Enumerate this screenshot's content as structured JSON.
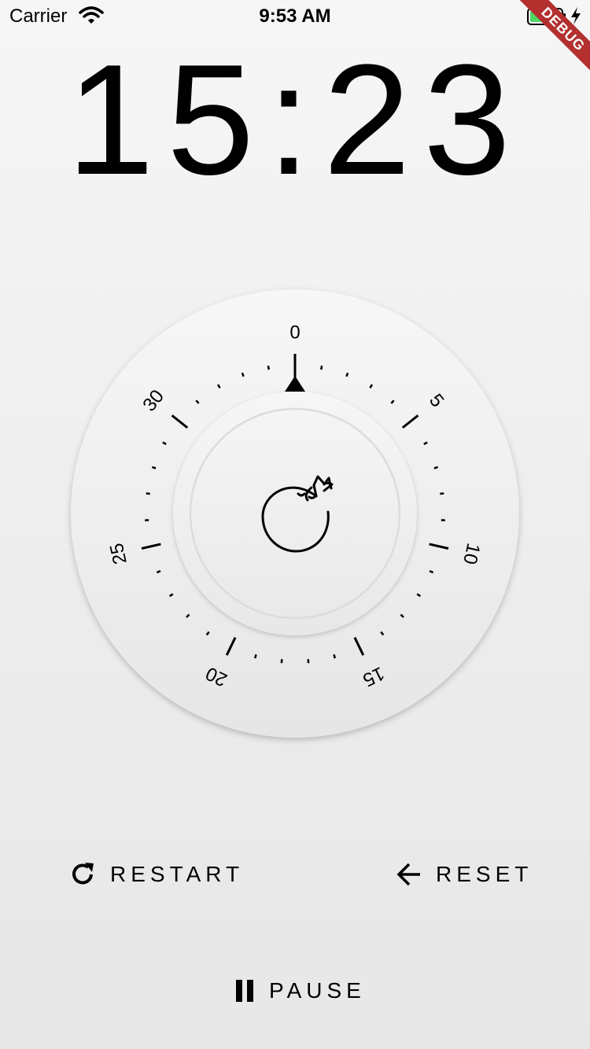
{
  "status_bar": {
    "carrier": "Carrier",
    "time": "9:53 AM"
  },
  "debug_banner": "DEBUG",
  "timer": {
    "display": "15:23"
  },
  "dial": {
    "labels": [
      "0",
      "5",
      "10",
      "15",
      "20",
      "25",
      "30"
    ],
    "minutes_total": 35,
    "center_icon": "sleeping-cat-icon"
  },
  "controls": {
    "restart_label": "RESTART",
    "reset_label": "RESET",
    "pause_label": "PAUSE"
  },
  "colors": {
    "battery_fill": "#4cd964",
    "debug_ribbon": "#b3302f"
  }
}
